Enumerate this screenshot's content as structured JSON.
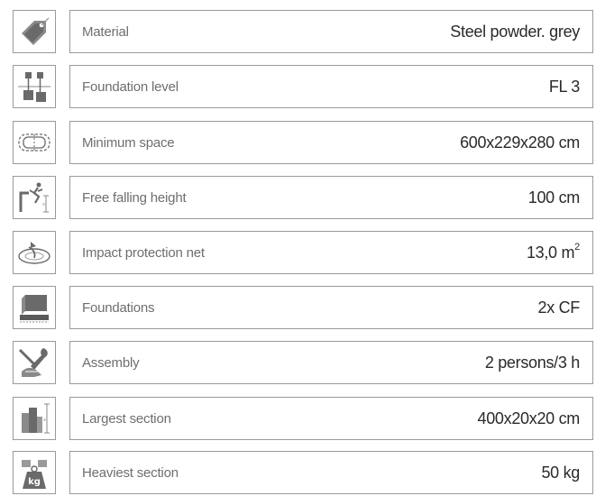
{
  "rows": [
    {
      "icon": "price-tag-icon",
      "label": "Material",
      "value": "Steel powder. grey"
    },
    {
      "icon": "foundation-level-icon",
      "label": "Foundation level",
      "value": "FL 3"
    },
    {
      "icon": "minimum-space-icon",
      "label": "Minimum space",
      "value": "600x229x280 cm"
    },
    {
      "icon": "free-fall-icon",
      "label": "Free falling height",
      "value": "100 cm"
    },
    {
      "icon": "impact-net-icon",
      "label": "Impact protection net",
      "value": "13,0 m",
      "value_sup": "2"
    },
    {
      "icon": "foundation-block-icon",
      "label": "Foundations",
      "value": "2x CF"
    },
    {
      "icon": "assembly-tools-icon",
      "label": "Assembly",
      "value": "2 persons/3 h"
    },
    {
      "icon": "largest-section-icon",
      "label": "Largest section",
      "value": "400x20x20 cm"
    },
    {
      "icon": "weight-kg-icon",
      "label": "Heaviest section",
      "value": "50 kg",
      "icon_text": "kg"
    }
  ]
}
